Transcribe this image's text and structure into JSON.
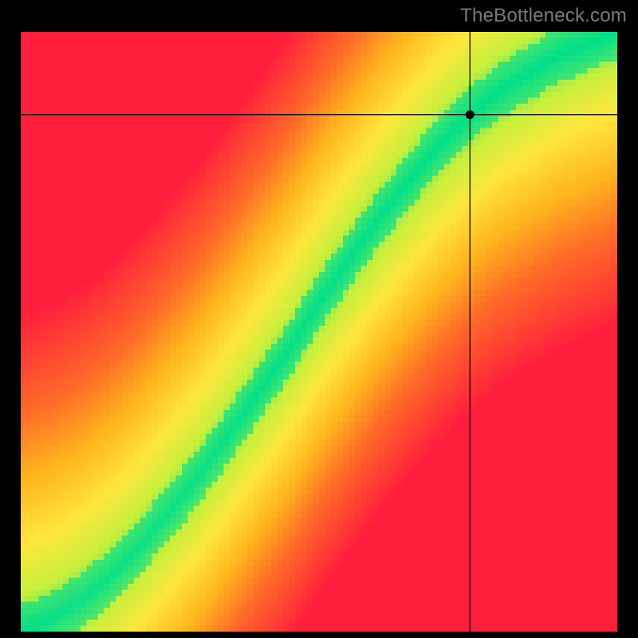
{
  "watermark": "TheBottleneck.com",
  "chart_data": {
    "type": "heatmap",
    "title": "",
    "xlabel": "",
    "ylabel": "",
    "xlim": [
      0,
      1
    ],
    "ylim": [
      0,
      1
    ],
    "crosshair": {
      "x": 0.753,
      "y": 0.862
    },
    "marker": {
      "x": 0.753,
      "y": 0.862
    },
    "ideal_curve_samples": [
      {
        "x": 0.0,
        "y": 0.0
      },
      {
        "x": 0.05,
        "y": 0.02
      },
      {
        "x": 0.1,
        "y": 0.05
      },
      {
        "x": 0.15,
        "y": 0.09
      },
      {
        "x": 0.2,
        "y": 0.14
      },
      {
        "x": 0.25,
        "y": 0.2
      },
      {
        "x": 0.3,
        "y": 0.26
      },
      {
        "x": 0.35,
        "y": 0.33
      },
      {
        "x": 0.4,
        "y": 0.4
      },
      {
        "x": 0.45,
        "y": 0.47
      },
      {
        "x": 0.5,
        "y": 0.55
      },
      {
        "x": 0.55,
        "y": 0.62
      },
      {
        "x": 0.6,
        "y": 0.69
      },
      {
        "x": 0.65,
        "y": 0.75
      },
      {
        "x": 0.7,
        "y": 0.81
      },
      {
        "x": 0.75,
        "y": 0.86
      },
      {
        "x": 0.8,
        "y": 0.9
      },
      {
        "x": 0.85,
        "y": 0.93
      },
      {
        "x": 0.9,
        "y": 0.96
      },
      {
        "x": 0.95,
        "y": 0.98
      },
      {
        "x": 1.0,
        "y": 1.0
      }
    ],
    "heatmap_grid": {
      "rows": 100,
      "cols": 100
    },
    "colormap_stops": [
      {
        "t": 1.0,
        "color": "#ff1e3c"
      },
      {
        "t": 0.7,
        "color": "#ff6a28"
      },
      {
        "t": 0.5,
        "color": "#ffb41e"
      },
      {
        "t": 0.3,
        "color": "#ffe63c"
      },
      {
        "t": 0.15,
        "color": "#c8f03c"
      },
      {
        "t": 0.0,
        "color": "#00df8a"
      }
    ],
    "band_halfwidth": 0.045
  }
}
